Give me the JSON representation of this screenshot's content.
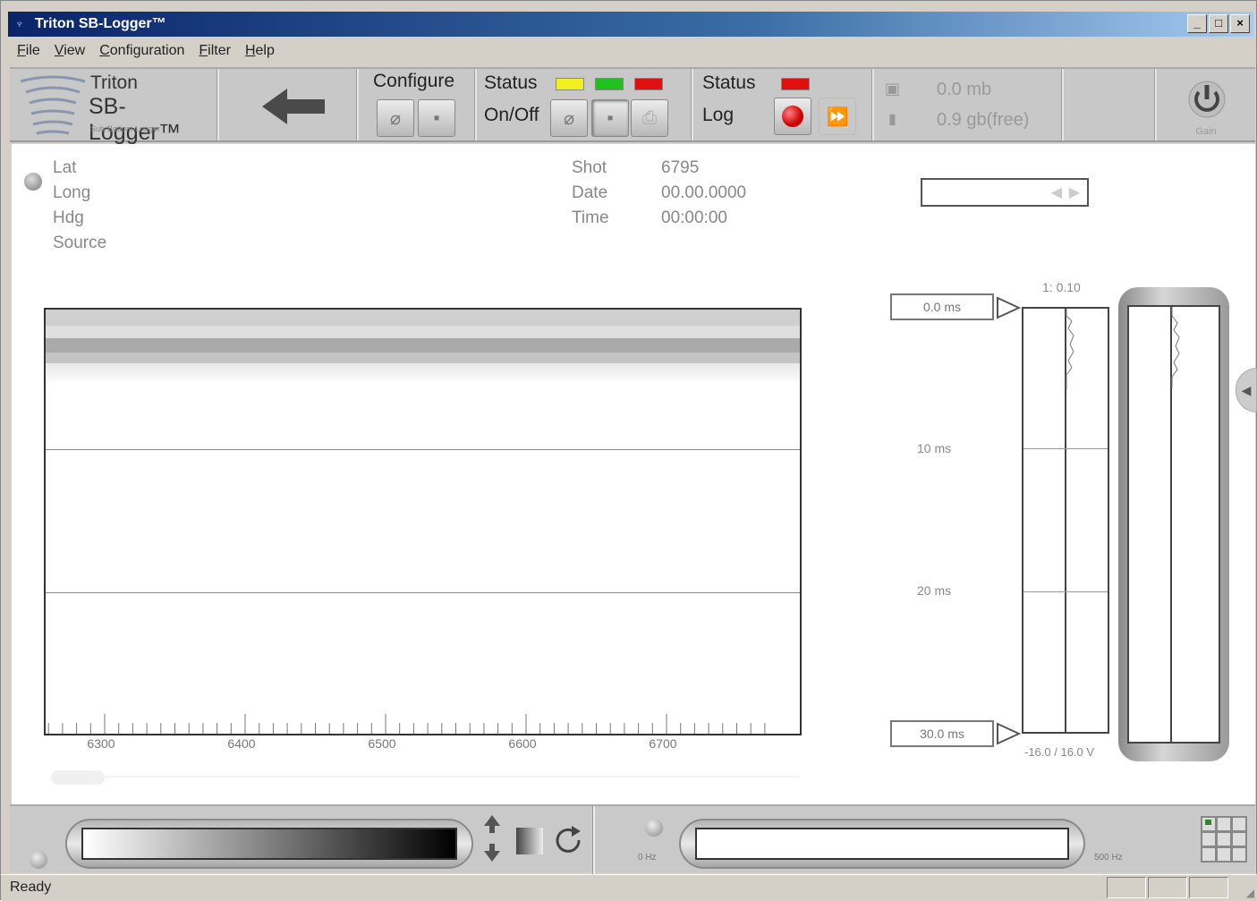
{
  "window": {
    "title": "Triton SB-Logger™",
    "min": "_",
    "max": "□",
    "close": "×"
  },
  "menu": [
    "File",
    "View",
    "Configuration",
    "Filter",
    "Help"
  ],
  "toolbar": {
    "logo": {
      "line1": "Triton",
      "line2": "SB-Logger™",
      "line3": "Sub-Bottom Logger"
    },
    "configure_label": "Configure",
    "status_label": "Status",
    "onoff_label": "On/Off",
    "log_status_label": "Status",
    "log_label": "Log",
    "leds": [
      "#f0f020",
      "#20c020",
      "#e01010"
    ],
    "log_led": "#e01010",
    "storage_used": "0.0 mb",
    "storage_free": "0.9 gb(free)",
    "gain_label": "Gain"
  },
  "nav": {
    "lat_label": "Lat",
    "long_label": "Long",
    "hdg_label": "Hdg",
    "source_label": "Source"
  },
  "shot": {
    "shot_label": "Shot",
    "shot_value": "6795",
    "date_label": "Date",
    "date_value": "00.00.0000",
    "time_label": "Time",
    "time_value": "00:00:00"
  },
  "plot": {
    "x_ticks": [
      "6300",
      "6400",
      "6500",
      "6600",
      "6700"
    ]
  },
  "depth": {
    "top_value": "0.0 ms",
    "bottom_value": "30.0 ms",
    "scale": "1: 0.10",
    "label_10": "10 ms",
    "label_20": "20 ms",
    "voltage": "-16.0 / 16.0 V"
  },
  "bottom": {
    "freq_low": "0 Hz",
    "freq_high": "500 Hz"
  },
  "status": {
    "text": "Ready"
  }
}
